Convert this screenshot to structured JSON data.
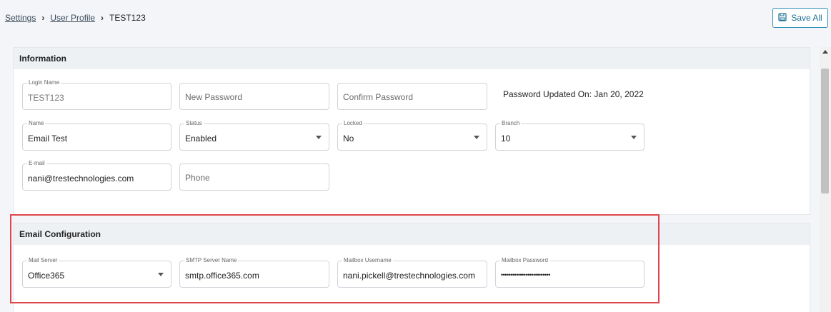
{
  "breadcrumb": {
    "items": [
      "Settings",
      "User Profile"
    ],
    "current": "TEST123"
  },
  "toolbar": {
    "save_label": "Save All"
  },
  "information": {
    "title": "Information",
    "login_name": {
      "label": "Login Name",
      "value": "TEST123"
    },
    "new_password": {
      "placeholder": "New Password"
    },
    "confirm_password": {
      "placeholder": "Confirm Password"
    },
    "password_updated": "Password Updated On: Jan 20, 2022",
    "name": {
      "label": "Name",
      "value": "Email Test"
    },
    "status": {
      "label": "Status",
      "value": "Enabled"
    },
    "locked": {
      "label": "Locked",
      "value": "No"
    },
    "branch": {
      "label": "Branch",
      "value": "10"
    },
    "email": {
      "label": "E-mail",
      "value": "nani@trestechnologies.com"
    },
    "phone": {
      "placeholder": "Phone"
    }
  },
  "email_config": {
    "title": "Email Configuration",
    "mail_server": {
      "label": "Mail Server",
      "value": "Office365"
    },
    "smtp_server": {
      "label": "SMTP Server Name",
      "value": "smtp.office365.com"
    },
    "mailbox_username": {
      "label": "Mailbox Username",
      "value": "nani.pickell@trestechnologies.com"
    },
    "mailbox_password": {
      "label": "Mailbox Password",
      "value": "••••••••••••••••••••••••••"
    }
  },
  "colors": {
    "accent": "#2f8fb6",
    "highlight": "#e0474c"
  }
}
